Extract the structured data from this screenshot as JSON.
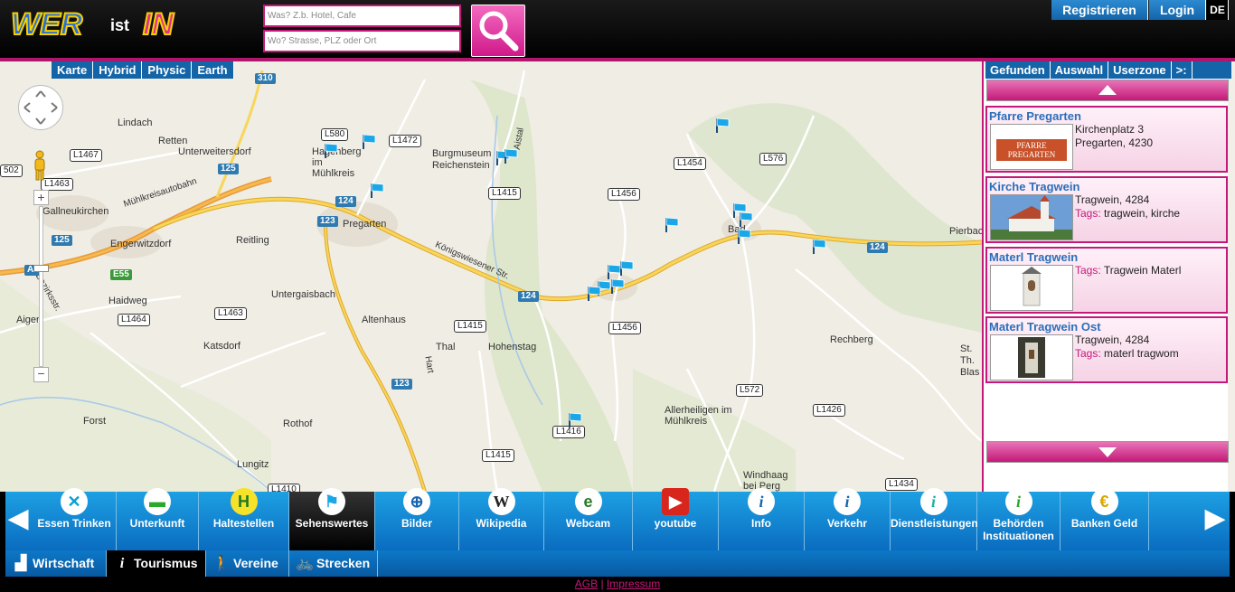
{
  "header": {
    "logo": {
      "text_a": "WER",
      "text_b": "ist",
      "text_c": "IN"
    },
    "search_what_placeholder": "Was? Z.b. Hotel, Cafe",
    "search_where_placeholder": "Wo? Strasse, PLZ oder Ort",
    "register_label": "Registrieren",
    "login_label": "Login",
    "lang_label": "DE"
  },
  "map_types": [
    "Karte",
    "Hybrid",
    "Physic",
    "Earth"
  ],
  "map": {
    "labels": [
      "Unterweitersdorf",
      "Gallneukirchen",
      "Engerwitzdorf",
      "Pregarten",
      "Untergaisbach",
      "Katsdorf",
      "Hagenberg im Mühlkreis",
      "Burgmuseum Reichenstein",
      "Allerheiligen im Mühlkreis",
      "Windhaag bei Perg",
      "Rechberg",
      "Reitling",
      "Haidweg",
      "Lindach",
      "Retten",
      "Forst",
      "Rothof",
      "Lungitz",
      "Altenhaus",
      "Hohenstag",
      "Thal",
      "Aigen",
      "Pierbach",
      "St. Th. Blas",
      "Mühlkreisautobahn",
      "Königswiesener Str.",
      "Aistal",
      "Hart",
      "Bad",
      "Bezirksstr."
    ],
    "road_signs": [
      "L1467",
      "L1463",
      "L580",
      "L1472",
      "L1415",
      "L1456",
      "L1454",
      "L576",
      "L1463",
      "L1464",
      "L1415",
      "L1456",
      "L572",
      "L1426",
      "L1415",
      "L1416",
      "L1410",
      "L1434",
      "502"
    ],
    "highway_signs": [
      "310",
      "125",
      "124",
      "123",
      "125",
      "E55",
      "A7",
      "124",
      "123",
      "124"
    ],
    "zoom_in": "+",
    "zoom_out": "−",
    "zoom_level_fraction": 0.39
  },
  "panel": {
    "tabs": [
      "Gefunden",
      "Auswahl",
      "Userzone",
      ">:"
    ],
    "tags_label": "Tags:",
    "results": [
      {
        "title": "Pfarre Pregarten",
        "thumb_text": "PFARRE PREGARTEN",
        "line1": "Kirchenplatz 3",
        "line2": "Pregarten, 4230",
        "tags": ""
      },
      {
        "title": "Kirche Tragwein",
        "line1": "Tragwein, 4284",
        "tags": "tragwein, kirche"
      },
      {
        "title": "Materl Tragwein",
        "tags": "Tragwein Materl"
      },
      {
        "title": "Materl Tragwein Ost",
        "line1": "Tragwein, 4284",
        "tags": "materl tragwom"
      }
    ]
  },
  "categories": [
    {
      "label": "Essen Trinken",
      "icon": "fork-knife-icon",
      "glyph": "✕"
    },
    {
      "label": "Unterkunft",
      "icon": "bed-icon",
      "glyph": "▬"
    },
    {
      "label": "Haltestellen",
      "icon": "bus-stop-icon",
      "glyph": "H"
    },
    {
      "label": "Sehenswertes",
      "icon": "flag-icon",
      "glyph": "⚑"
    },
    {
      "label": "Bilder",
      "icon": "camera-icon",
      "glyph": "⊕"
    },
    {
      "label": "Wikipedia",
      "icon": "wikipedia-icon",
      "glyph": "W"
    },
    {
      "label": "Webcam",
      "icon": "webcam-icon",
      "glyph": "e"
    },
    {
      "label": "youtube",
      "icon": "youtube-icon",
      "glyph": "▶"
    },
    {
      "label": "Info",
      "icon": "info-icon",
      "glyph": "i"
    },
    {
      "label": "Verkehr",
      "icon": "info-icon",
      "glyph": "i"
    },
    {
      "label": "Dienstleistungen",
      "icon": "info-icon",
      "glyph": "i"
    },
    {
      "label": "Behörden Instituationen",
      "icon": "info-icon",
      "glyph": "i"
    },
    {
      "label": "Banken Geld",
      "icon": "euro-icon",
      "glyph": "€"
    }
  ],
  "sub_categories": [
    {
      "label": "Wirtschaft",
      "icon": "factory-icon",
      "glyph": "▟"
    },
    {
      "label": "Tourismus",
      "icon": "info-icon",
      "glyph": "i"
    },
    {
      "label": "Vereine",
      "icon": "walker-icon",
      "glyph": "🚶"
    },
    {
      "label": "Strecken",
      "icon": "bicycle-icon",
      "glyph": "🚲"
    }
  ],
  "footer": {
    "agb": "AGB",
    "separator": "|",
    "impressum": "Impressum"
  },
  "colors": {
    "brand_pink": "#c41978",
    "brand_blue": "#1365a8",
    "flag_cyan": "#1aa7e8"
  }
}
